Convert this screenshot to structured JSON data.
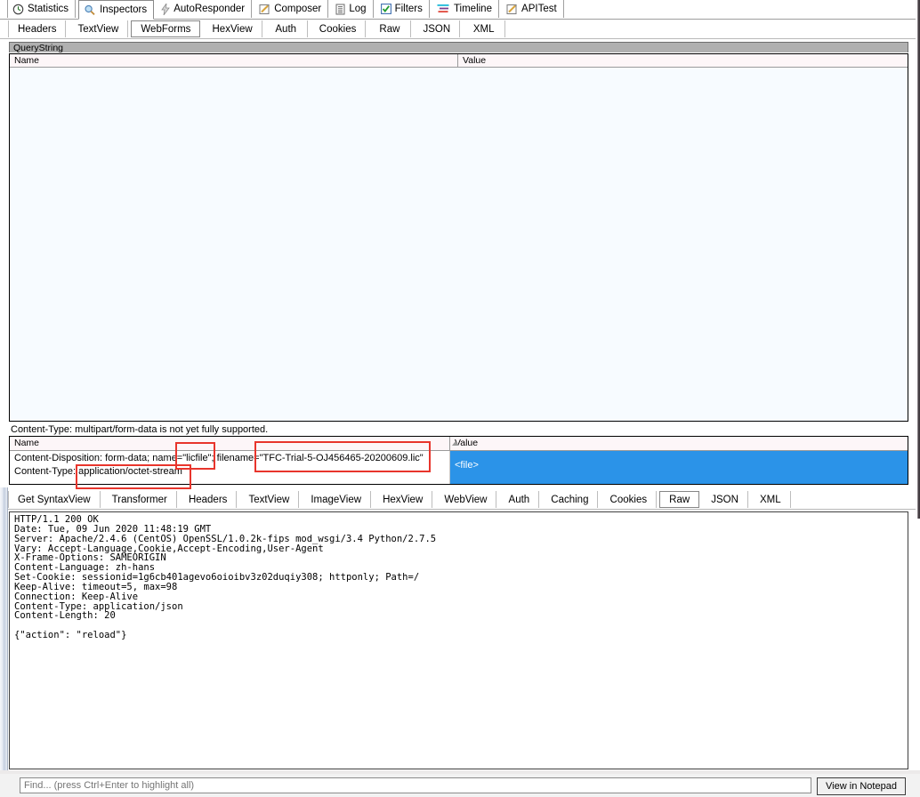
{
  "main_tabs": [
    {
      "label": "Statistics",
      "icon": "clock-icon",
      "active": false
    },
    {
      "label": "Inspectors",
      "icon": "magnifier-icon",
      "active": true
    },
    {
      "label": "AutoResponder",
      "icon": "lightning-icon",
      "active": false
    },
    {
      "label": "Composer",
      "icon": "pencil-note-icon",
      "active": false
    },
    {
      "label": "Log",
      "icon": "list-icon",
      "active": false
    },
    {
      "label": "Filters",
      "icon": "checkbox-icon",
      "active": false
    },
    {
      "label": "Timeline",
      "icon": "timeline-icon",
      "active": false
    },
    {
      "label": "APITest",
      "icon": "pencil-note-icon",
      "active": false
    }
  ],
  "request_tabs": [
    {
      "label": "Headers",
      "active": false
    },
    {
      "label": "TextView",
      "active": false
    },
    {
      "label": "WebForms",
      "active": true
    },
    {
      "label": "HexView",
      "active": false
    },
    {
      "label": "Auth",
      "active": false
    },
    {
      "label": "Cookies",
      "active": false
    },
    {
      "label": "Raw",
      "active": false
    },
    {
      "label": "JSON",
      "active": false
    },
    {
      "label": "XML",
      "active": false
    }
  ],
  "querystring": {
    "band_label": "QueryString",
    "columns": [
      "Name",
      "Value"
    ],
    "rows": []
  },
  "notice": "Content-Type: multipart/form-data is not yet fully supported.",
  "body_grid": {
    "columns": [
      "Name",
      "Value"
    ],
    "sort_indicator": "ascending-sort-arrow",
    "rows": [
      {
        "name_line1": "Content-Disposition: form-data; name=\"licfile\"; filename=\"TFC-Trial-5-OJ456465-20200609.lic\"",
        "name_line2": "Content-Type: application/octet-stream",
        "value": "<file>",
        "selected": true
      }
    ]
  },
  "annotations": [
    {
      "id": "annot-name",
      "target": "name=\"licfile\"",
      "color": "#e8352c"
    },
    {
      "id": "annot-file",
      "target": "filename=\"TFC-Trial-5-OJ456465-20200609.lic\"",
      "color": "#e8352c"
    },
    {
      "id": "annot-ctype",
      "target": "application/octet-stream",
      "color": "#e8352c"
    }
  ],
  "response_tabs": [
    {
      "label": "Get SyntaxView",
      "active": false
    },
    {
      "label": "Transformer",
      "active": false
    },
    {
      "label": "Headers",
      "active": false
    },
    {
      "label": "TextView",
      "active": false
    },
    {
      "label": "ImageView",
      "active": false
    },
    {
      "label": "HexView",
      "active": false
    },
    {
      "label": "WebView",
      "active": false
    },
    {
      "label": "Auth",
      "active": false
    },
    {
      "label": "Caching",
      "active": false
    },
    {
      "label": "Cookies",
      "active": false
    },
    {
      "label": "Raw",
      "active": true
    },
    {
      "label": "JSON",
      "active": false
    },
    {
      "label": "XML",
      "active": false
    }
  ],
  "raw_response": "HTTP/1.1 200 OK\nDate: Tue, 09 Jun 2020 11:48:19 GMT\nServer: Apache/2.4.6 (CentOS) OpenSSL/1.0.2k-fips mod_wsgi/3.4 Python/2.7.5\nVary: Accept-Language,Cookie,Accept-Encoding,User-Agent\nX-Frame-Options: SAMEORIGIN\nContent-Language: zh-hans\nSet-Cookie: sessionid=1g6cb401agevo6oioibv3z02duqiy308; httponly; Path=/\nKeep-Alive: timeout=5, max=98\nConnection: Keep-Alive\nContent-Type: application/json\nContent-Length: 20\n\n{\"action\": \"reload\"}",
  "footer": {
    "find_placeholder": "Find... (press Ctrl+Enter to highlight all)",
    "find_value": "",
    "notepad_button": "View in Notepad"
  }
}
